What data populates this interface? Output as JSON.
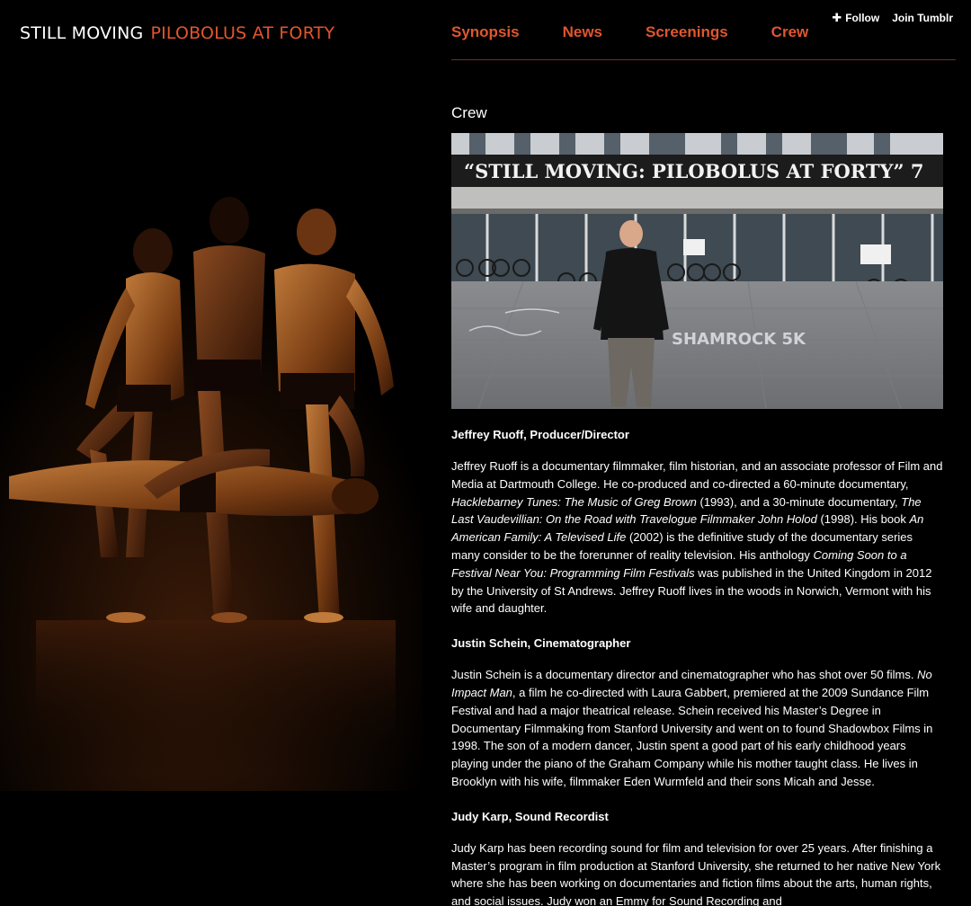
{
  "site": {
    "title_white": "STILL MOVING",
    "title_orange": "PILOBOLUS AT FORTY"
  },
  "nav": {
    "items": [
      "Synopsis",
      "News",
      "Screenings",
      "Crew"
    ]
  },
  "tumblr": {
    "follow_label": "Follow",
    "join_label": "Join Tumblr"
  },
  "main": {
    "title": "Crew",
    "photo": {
      "banner_text": "“STILL MOVING: PILOBOLUS AT FORTY” 7",
      "chalk_text": "SHAMROCK 5K"
    },
    "crew": [
      {
        "name": "Jeffrey Ruoff, Producer/Director",
        "bio_parts": [
          {
            "t": "Jeffrey Ruoff is a documentary filmmaker, film historian, and an associate professor of Film and Media at Dartmouth College.  He co-produced and co-directed a 60-minute documentary, "
          },
          {
            "t": "Hacklebarney Tunes: The Music of Greg Brown",
            "i": true
          },
          {
            "t": " (1993), and a 30-minute documentary, "
          },
          {
            "t": "The Last Vaudevillian: On the Road with Travelogue Filmmaker John Holod",
            "i": true
          },
          {
            "t": " (1998).  His book "
          },
          {
            "t": "An American Family: A Televised Life",
            "i": true
          },
          {
            "t": " (2002) is the definitive study of the documentary series many consider to be the forerunner of reality television.  His anthology "
          },
          {
            "t": "Coming Soon to a Festival Near You: Programming Film Festivals",
            "i": true
          },
          {
            "t": " was published in the United Kingdom in 2012 by the University of St Andrews. Jeffrey Ruoff lives in the woods in Norwich, Vermont with his wife and daughter."
          }
        ]
      },
      {
        "name": "Justin Schein, Cinematographer",
        "bio_parts": [
          {
            "t": "Justin Schein is a documentary director and cinematographer who has shot over 50 films.  "
          },
          {
            "t": "No Impact Man",
            "i": true
          },
          {
            "t": ", a film he co-directed with Laura Gabbert, premiered at the 2009 Sundance Film Festival and had a major theatrical release.  Schein received his Master’s Degree in Documentary Filmmaking from Stanford University and went on to found Shadowbox Films in 1998.  The son of a modern dancer, Justin spent a good part of his early childhood years playing under the piano of the Graham Company while his mother taught class.  He lives in Brooklyn with his wife, filmmaker Eden Wurmfeld and their sons Micah and Jesse."
          }
        ]
      },
      {
        "name": "Judy Karp, Sound Recordist",
        "bio_parts": [
          {
            "t": "Judy Karp has been recording sound for film and television for over 25 years.  After finishing a Master’s program in film production at Stanford University, she returned to her native New York where she has been working on documentaries and fiction films about the arts, human rights, and social issues.  Judy won an Emmy for Sound Recording and"
          }
        ]
      }
    ]
  },
  "colors": {
    "background": "#000000",
    "accent": "#e0562f",
    "nav_rule": "#7a2a16",
    "text": "#ffffff"
  },
  "icons": {
    "follow": "plus-icon"
  }
}
